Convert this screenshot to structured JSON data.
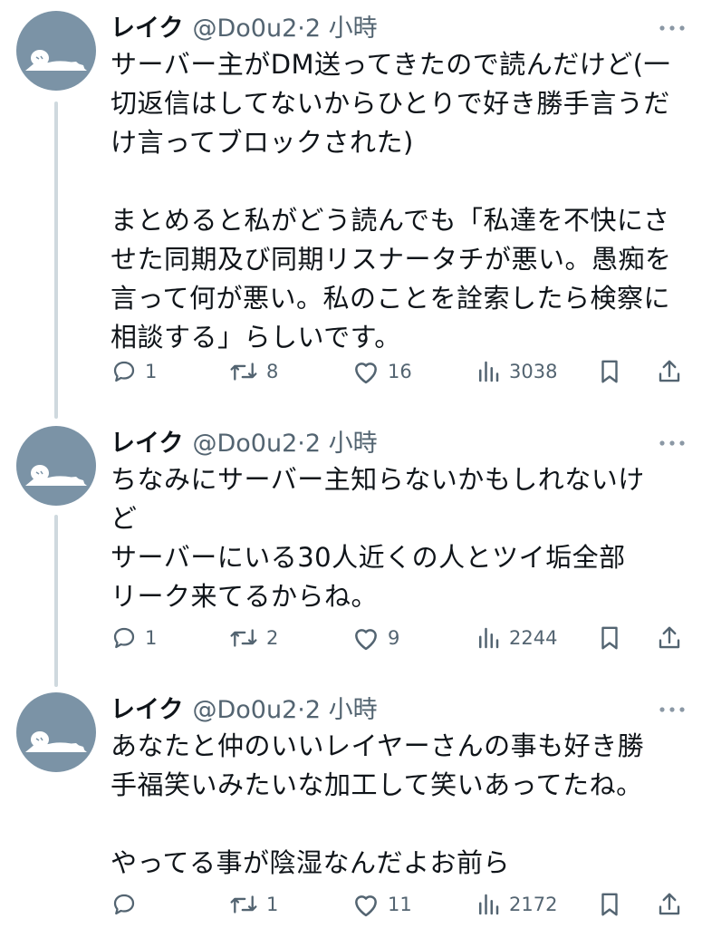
{
  "tweets": [
    {
      "name": "レイク",
      "handle_time": "@Do0u2·2 小時",
      "text": "サーバー主がDM送ってきたので読んだけど(一\n切返信はしてないからひとりで好き勝手言うだ\nけ言ってブロックされた)\n\nまとめると私がどう読んでも「私達を不快にさ\nせた同期及び同期リスナータチが悪い。愚痴を\n言って何が悪い。私のことを詮索したら検察に\n相談する」らしいです。",
      "replies": "1",
      "retweets": "8",
      "likes": "16",
      "views": "3038"
    },
    {
      "name": "レイク",
      "handle_time": "@Do0u2·2 小時",
      "text": "ちなみにサーバー主知らないかもしれないけ\nど\nサーバーにいる30人近くの人とツイ垢全部\nリーク来てるからね。",
      "replies": "1",
      "retweets": "2",
      "likes": "9",
      "views": "2244"
    },
    {
      "name": "レイク",
      "handle_time": "@Do0u2·2 小時",
      "text": "あなたと仲のいいレイヤーさんの事も好き勝\n手福笑いみたいな加工して笑いあってたね。\n\nやってる事が陰湿なんだよお前ら",
      "replies": "",
      "retweets": "1",
      "likes": "11",
      "views": "2172"
    }
  ],
  "icons": {
    "reply": "reply-icon",
    "retweet": "retweet-icon",
    "like": "heart-icon",
    "views": "views-icon",
    "bookmark": "bookmark-icon",
    "share": "share-icon",
    "more": "more-icon"
  },
  "colors": {
    "text": "#0f1419",
    "secondary": "#536471",
    "thread_line": "#cfd9de",
    "avatar_bg": "#7b93a6"
  }
}
